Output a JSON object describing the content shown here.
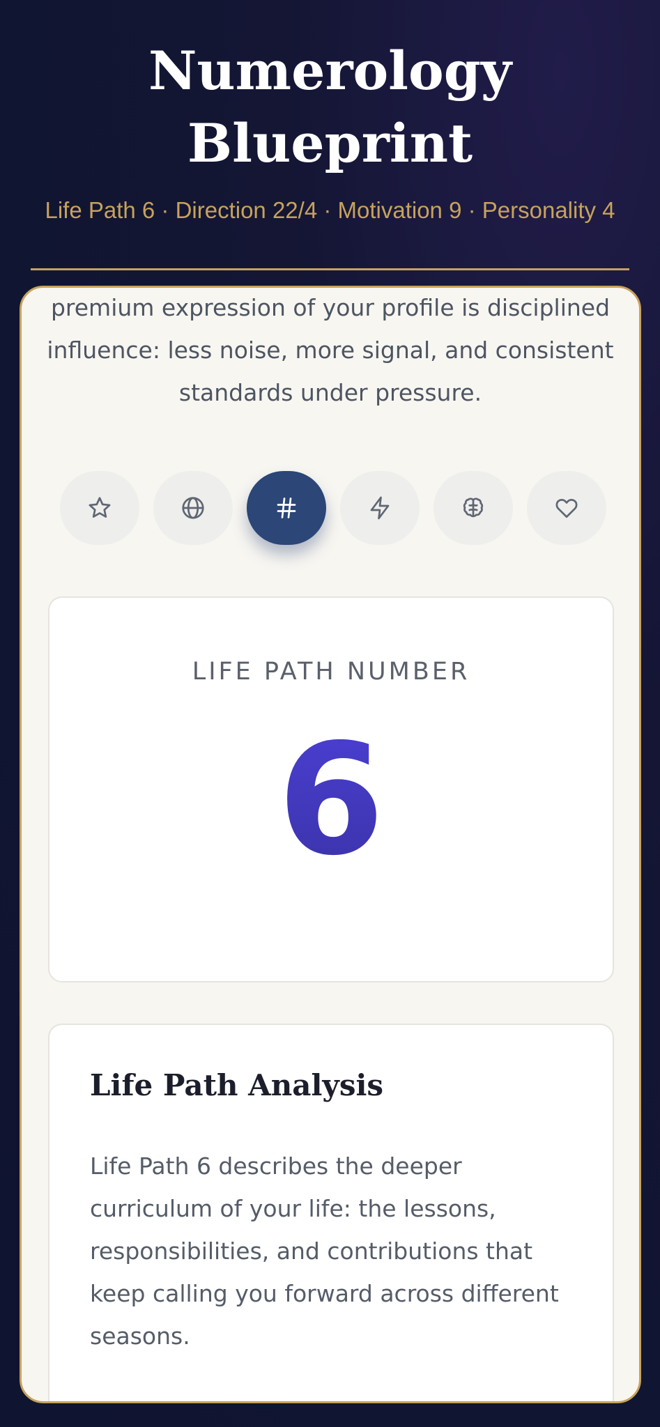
{
  "header": {
    "title": "Numerology Blueprint",
    "subtitle": "Life Path 6 · Direction 22/4 · Motivation 9 · Personality 4"
  },
  "intro": {
    "text": "premium expression of your profile is disciplined influence: less noise, more signal, and consistent standards under pressure."
  },
  "tabs": [
    {
      "icon": "star-icon",
      "active": false
    },
    {
      "icon": "globe-icon",
      "active": false
    },
    {
      "icon": "hash-icon",
      "active": true
    },
    {
      "icon": "lightning-icon",
      "active": false
    },
    {
      "icon": "brain-icon",
      "active": false
    },
    {
      "icon": "heart-icon",
      "active": false
    }
  ],
  "number_card": {
    "label": "LIFE PATH NUMBER",
    "value": "6"
  },
  "analysis_card": {
    "heading": "Life Path Analysis",
    "body": "Life Path 6 describes the deeper curriculum of your life: the lessons, responsibilities, and contributions that keep calling you forward across different seasons."
  },
  "colors": {
    "accent_gold": "#c8a25c",
    "active_tab": "#2b4677",
    "number_gradient_top": "#4b3fd3",
    "number_gradient_bottom": "#3a33a8"
  }
}
